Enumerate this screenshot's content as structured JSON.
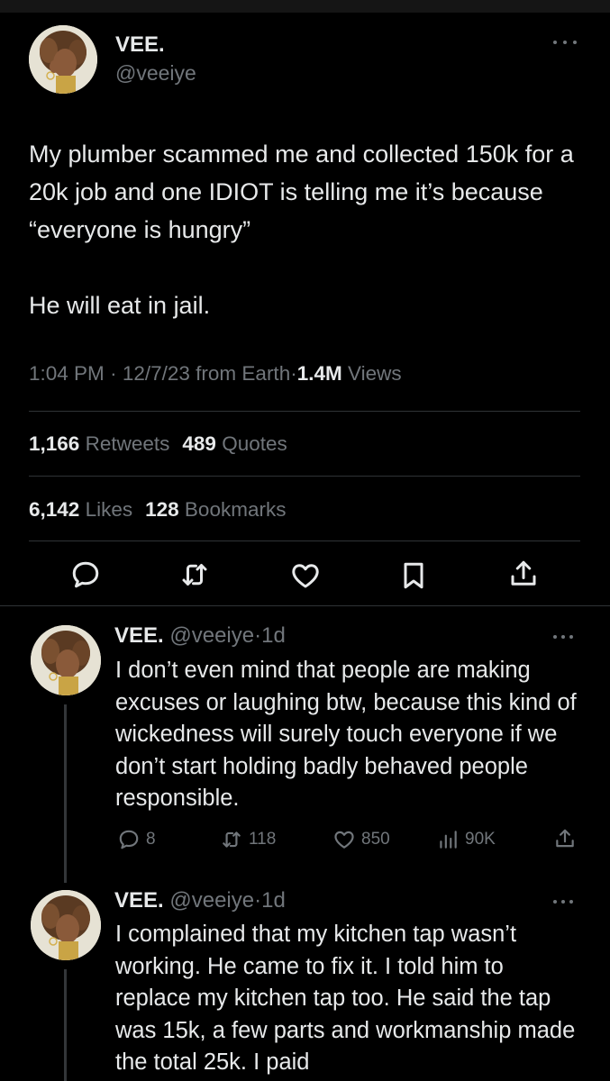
{
  "main_tweet": {
    "display_name": "VEE.",
    "handle": "@veeiye",
    "text": "My plumber scammed me and collected 150k for a 20k job and one IDIOT is telling me it’s because “everyone is hungry”\n\nHe will eat in jail.",
    "time": "1:04 PM",
    "date": "12/7/23",
    "source": "from Earth",
    "views_count": "1.4M",
    "views_label": "Views",
    "retweets_count": "1,166",
    "retweets_label": "Retweets",
    "quotes_count": "489",
    "quotes_label": "Quotes",
    "likes_count": "6,142",
    "likes_label": "Likes",
    "bookmarks_count": "128",
    "bookmarks_label": "Bookmarks"
  },
  "replies": [
    {
      "display_name": "VEE.",
      "handle": "@veeiye",
      "age": "1d",
      "text": "I don’t even mind that people are making excuses or laughing btw, because this kind of wickedness will surely touch everyone if we don’t start holding badly behaved people responsible.",
      "replies": "8",
      "retweets": "118",
      "likes": "850",
      "views": "90K"
    },
    {
      "display_name": "VEE.",
      "handle": "@veeiye",
      "age": "1d",
      "text": "I complained that my kitchen tap wasn’t working. He came to fix it. I told him to replace my kitchen tap too. He said the tap was 15k, a few parts and workmanship made the total 25k. I paid"
    }
  ],
  "icons": {
    "reply": "speech-bubble-icon",
    "retweet": "retweet-icon",
    "like": "heart-icon",
    "bookmark": "bookmark-icon",
    "share": "share-icon",
    "views": "bar-chart-icon",
    "more": "more-dots-icon"
  },
  "colors": {
    "background": "#000000",
    "primary_text": "#e7e9ea",
    "secondary_text": "#71767b",
    "divider": "#2f3336"
  }
}
